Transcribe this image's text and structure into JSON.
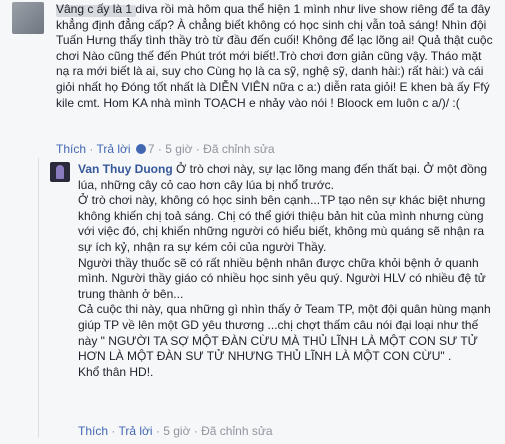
{
  "comment": {
    "author": "",
    "text": "Vâng c ấy là 1 diva rồi mà hôm qua thể hiện 1 mình như live show riêng để ta đây khẳng định đẳng cấp? À chẳng biết không có học sinh chị vẫn toả sáng! Nhìn đội Tuấn Hưng thấy tình thầy trò từ đầu đến cuối! Không để lạc lõng ai! Quả thật cuộc chơi Nào cũng thế đến Phút trót mới biết!.Trò chơi đơn giản cũng vậy. Tháo mặt nạ ra mới biết là ai, suy cho Cùng họ là ca sỹ, nghệ sỹ, danh hài:) rất hài:) và cái giỏi nhất họ Đóng tốt nhất là DIỄN VIÊN nữa c a:) diễn rata giỏi! E khen bà ấy Ffý kile cmt. Hom KA nhà mình TOẠCH e nhảy vào nói ! Bloock em luôn c a/)/ :(",
    "actions": {
      "reply": "Thích",
      "sep1": " · ",
      "reply_label": "Trả lời",
      "likes": "7",
      "sep2": " · ",
      "time": "5 giờ",
      "sep3": " · ",
      "edited": "Đã chỉnh sửa"
    }
  },
  "reply": {
    "author": "Van Thuy Duong",
    "text": " Ở trò chơi này, sự lạc lõng mang đến thất bại. Ở một đồng lúa, những cây cỏ cao hơn cây lúa bị nhổ trước.\nỞ trò chơi này, không có học sinh bên cạnh...TP tạo nên sự khác biệt nhưng không khiến chị toả sáng. Chị có thể giới thiệu bản hit của mình nhưng cùng với việc đó, chị khiến những người có hiểu biết, không mù quáng sẽ nhận ra sự ích kỷ, nhận ra sự kém cỏi của người Thầy.\nNgười thầy thuốc sẽ có rất nhiều bệnh nhân được chữa khỏi bệnh ở quanh mình. Người thầy giáo có nhiều học sinh yêu quý. Người HLV có nhiều đệ tử trung thành ở bên...\nCả cuộc thi này, qua những gì nhìn thấy ở Team TP, một đội quân hùng mạnh giúp TP về lên một GD yêu thương ...chị chợt thấm câu nói đại loại như thế này \" NGƯỜI TA SỢ MỘT ĐÀN CỪU MÀ THỦ LĨNH LÀ MỘT CON SƯ TỬ HƠN LÀ MỘT ĐÀN SƯ TỬ NHƯNG THỦ LĨNH LÀ MỘT CON CỪU\" .\nKhổ thân HD!.",
    "actions": {
      "like": "Thích",
      "sep1": " · ",
      "reply_label": "Trả lời",
      "sep2": " · ",
      "time": "5 giờ",
      "sep3": " · ",
      "edited": "Đã chỉnh sửa"
    }
  }
}
